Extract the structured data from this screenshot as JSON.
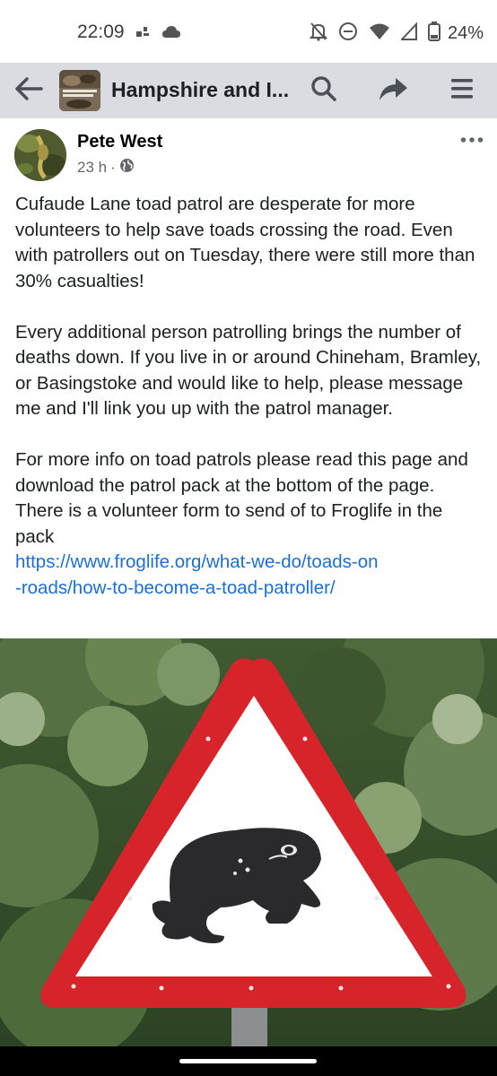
{
  "status_bar": {
    "time": "22:09",
    "battery": "24%",
    "icons": [
      "network-swap-icon",
      "cloud-icon",
      "bell-off-icon",
      "do-not-disturb-icon",
      "wifi-icon",
      "signal-icon",
      "battery-icon"
    ]
  },
  "header": {
    "title": "Hampshire and I...",
    "icons": [
      "back-arrow-icon",
      "search-icon",
      "share-icon",
      "menu-icon"
    ],
    "background": "#d9dde2"
  },
  "post": {
    "author": "Pete West",
    "time": "23 h",
    "separator": "·",
    "audience_icon": "globe-icon",
    "paragraphs": [
      "Cufaude Lane toad patrol are desperate for more volunteers to help save toads crossing the road. Even with patrollers out on Tuesday, there were still more than 30% casualties!",
      "Every additional person patrolling brings the number of deaths down. If you live in or around Chineham, Bramley, or Basingstoke and would like to help, please message me and I'll link you up with the patrol manager.",
      "For more info on toad patrols please read this page and download the patrol pack at the bottom of the page. There is a volunteer form to send of to Froglife in the pack"
    ],
    "link_line_1": "https://www.froglife.org/what-we-do/toads-on",
    "link_line_2": "-roads/how-to-become-a-toad-patroller/",
    "link_color": "#1a6fd8",
    "image": "toad-crossing-warning-sign"
  }
}
